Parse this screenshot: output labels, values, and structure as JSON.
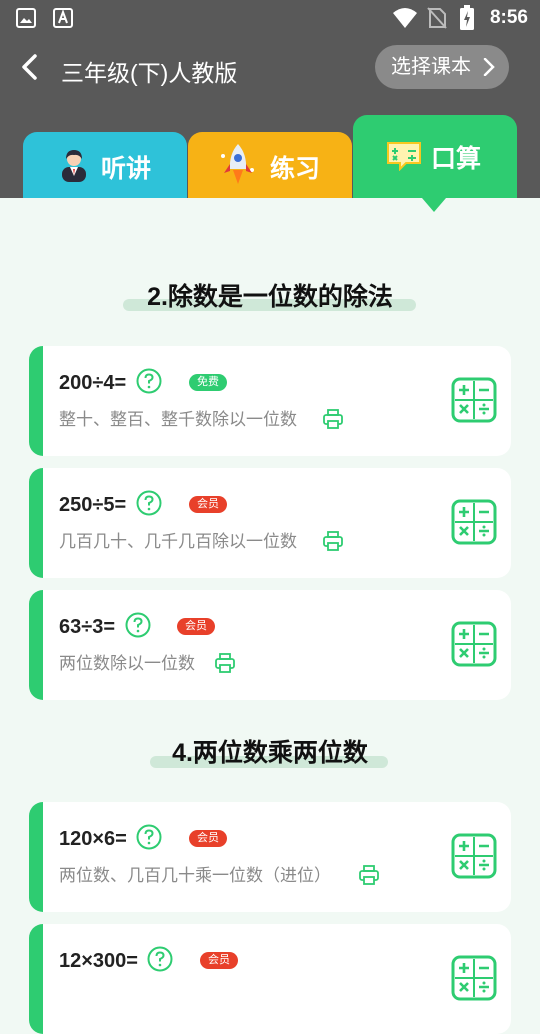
{
  "status": {
    "time": "8:56"
  },
  "header": {
    "title": "三年级(下)人教版",
    "select_label": "选择课本"
  },
  "tabs": [
    {
      "label": "听讲"
    },
    {
      "label": "练习"
    },
    {
      "label": "口算"
    }
  ],
  "sections": [
    {
      "title": "2.除数是一位数的除法",
      "cards": [
        {
          "expr": "200÷4=",
          "badge": "免费",
          "desc": "整十、整百、整千数除以一位数"
        },
        {
          "expr": "250÷5=",
          "badge": "会员",
          "desc": "几百几十、几千几百除以一位数"
        },
        {
          "expr": "63÷3=",
          "badge": "会员",
          "desc": "两位数除以一位数"
        }
      ]
    },
    {
      "title": "4.两位数乘两位数",
      "cards": [
        {
          "expr": "120×6=",
          "badge": "会员",
          "desc": "两位数、几百几十乘一位数（进位）"
        },
        {
          "expr": "12×300=",
          "badge": "会员",
          "desc": ""
        }
      ]
    }
  ],
  "colors": {
    "green": "#2ecc71",
    "cyan": "#2ec2d9",
    "yellow": "#f7b215",
    "red": "#e8402a",
    "header": "#595959"
  }
}
